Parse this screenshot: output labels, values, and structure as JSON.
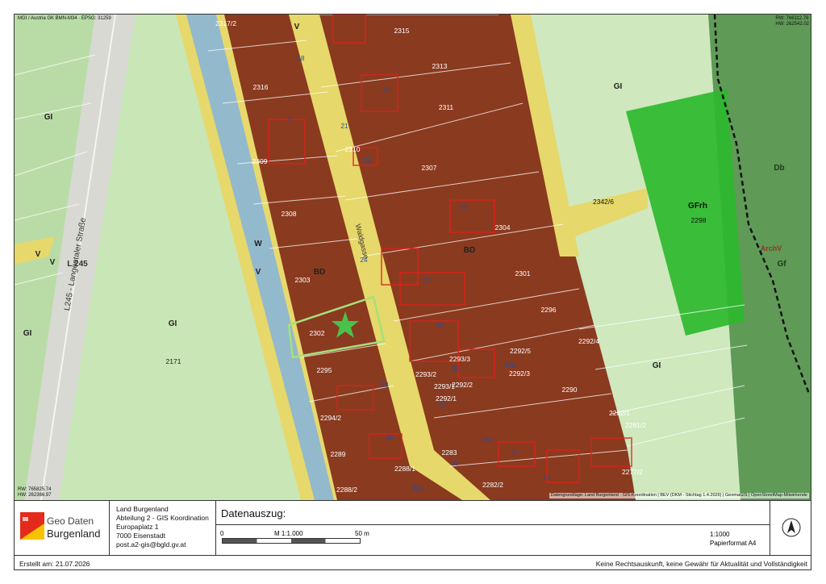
{
  "header": {
    "crs_label": "MGI / Austria GK BMN-M34 · EPSG: 31259",
    "coord_top_right": {
      "rw": "RW: 766112.76",
      "hw": "HW: 262542.02"
    },
    "coord_bottom_left": {
      "rw": "RW: 765825.74",
      "hw": "HW: 262366.97"
    }
  },
  "map": {
    "parcels": [
      "2317/2",
      "2315",
      "2313",
      "2316",
      "2311",
      "2309",
      "2310",
      "2307",
      "2308",
      "2304",
      "2303",
      "2301",
      "2302",
      "2296",
      "2295",
      "2292/5",
      "2292/4",
      "2293/3",
      "2293/2",
      "2293/1",
      "2292/3",
      "2292/2",
      "2292/1",
      "2290",
      "2294/2",
      "2282/1",
      "2281/2",
      "2289",
      "2288/1",
      "2283",
      "2277/2",
      "2288/2",
      "2282/2",
      "2342/6",
      "2298",
      "2171"
    ],
    "house_numbers": [
      "18",
      "19",
      "20",
      "21",
      "23",
      "24",
      "25",
      "27",
      "28",
      "29",
      "30",
      "31",
      "31a",
      "33",
      "35",
      "35a",
      "37",
      "39",
      "30a"
    ],
    "zones": [
      "GI",
      "GI",
      "GI",
      "GI",
      "GI",
      "GFrh",
      "Db",
      "Gf",
      "BD",
      "BD",
      "V",
      "V",
      "V",
      "W",
      "V"
    ],
    "road_labels": [
      "L245 - Langentaler Straße",
      "L 245",
      "Waldgasse"
    ],
    "archv_label": "ArchV",
    "attribution": "Datengrundlage: Land Burgenland · GIS-Koordination | BEV (DKM - Stichtag 1.4.2026) | GeomaGIS | OpenStreetMap-Mitwirkende"
  },
  "footer": {
    "logo_line1": "Geo Daten",
    "logo_line2": "Burgenland",
    "address": [
      "Land Burgenland",
      "Abteilung 2 - GIS Koordination",
      "Europaplatz 1",
      "7000 Eisenstadt",
      "post.a2-gis@bgld.gv.at"
    ],
    "title": "Datenauszug:",
    "scale_labels": {
      "zero": "0",
      "mid": "M 1:1.000",
      "end": "50 m"
    },
    "scale_text": "1:1000",
    "paper_format": "Papierformat A4",
    "north_label": "N"
  },
  "bottom": {
    "created": "Erstellt am: 21.07.2026",
    "disclaimer": "Keine Rechtsauskunft, keine Gewähr für Aktualität und Vollständigkeit"
  },
  "colors": {
    "built_zone": "#8a3a1f",
    "green_zone": "#bfe3a8",
    "dark_green": "#5f9a57",
    "road_yellow": "#e6d86a",
    "water_blue": "#93b9cc",
    "highlight_green": "#2eb82e",
    "outline_red": "#e0201a"
  }
}
